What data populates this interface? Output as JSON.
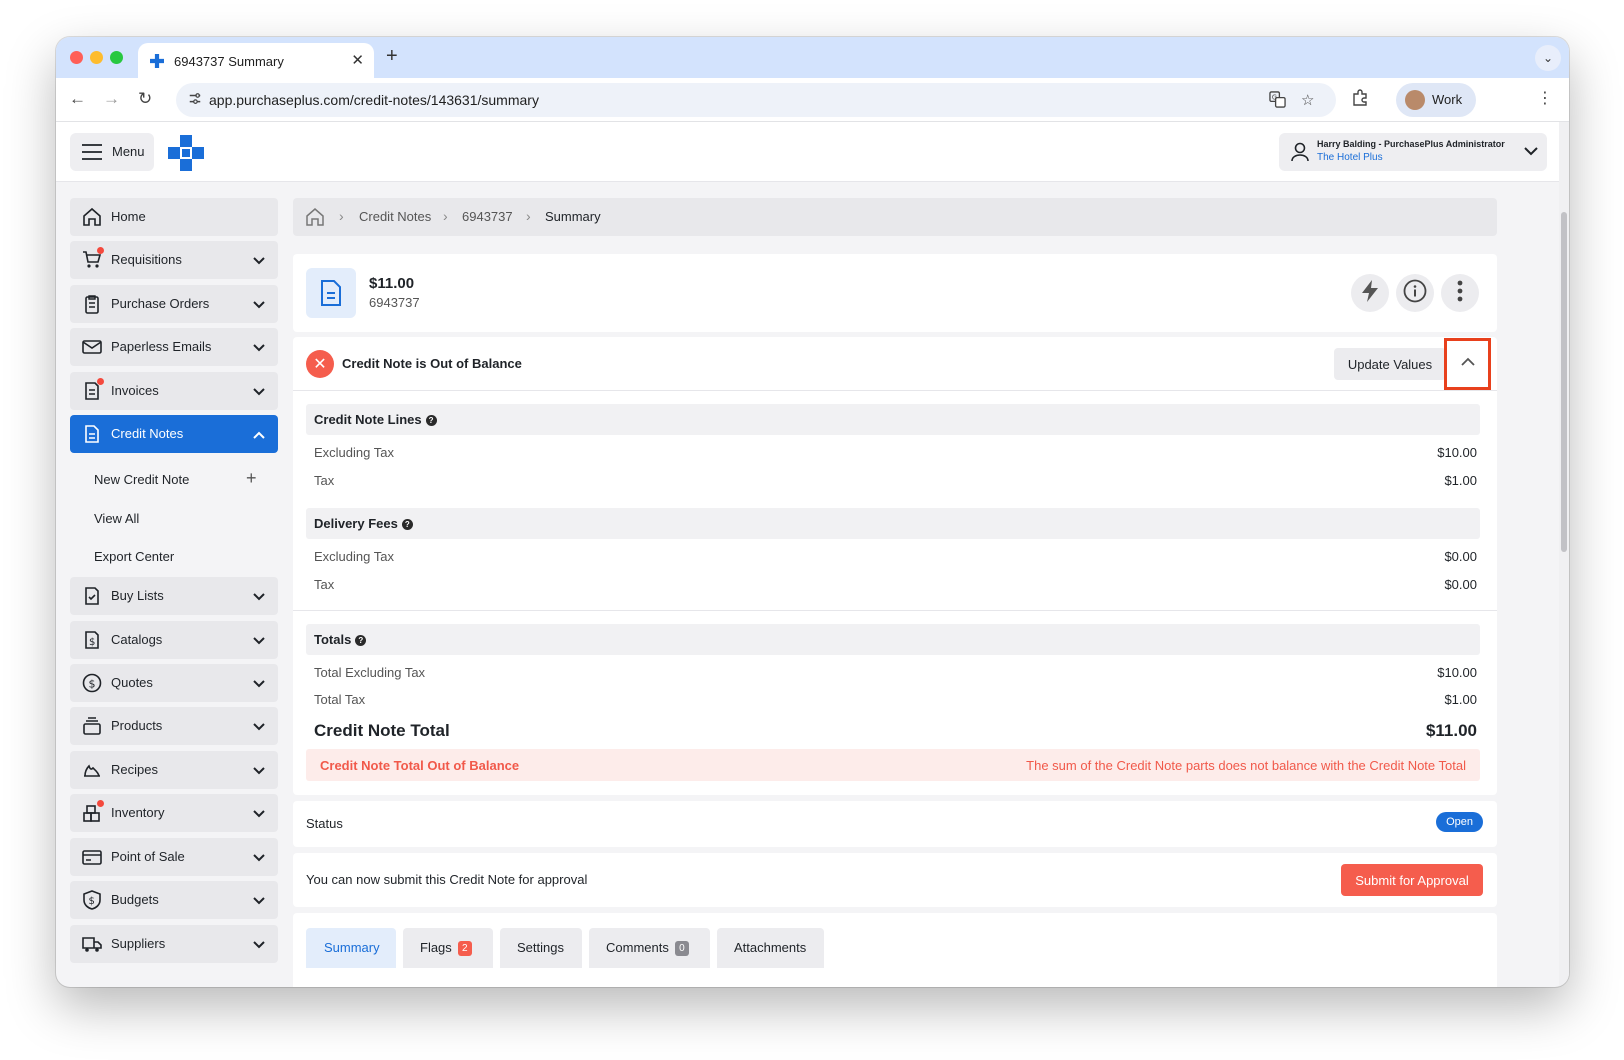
{
  "browser": {
    "tab_title": "6943737 Summary",
    "url": "app.purchaseplus.com/credit-notes/143631/summary",
    "profile_label": "Work",
    "traffic_colors": [
      "#ff5f57",
      "#febc2e",
      "#28c840"
    ]
  },
  "header": {
    "menu_label": "Menu",
    "user_name": "Harry Balding - PurchasePlus Administrator",
    "user_org": "The Hotel Plus"
  },
  "sidebar": {
    "items": [
      {
        "label": "Home",
        "icon": "home-icon"
      },
      {
        "label": "Requisitions",
        "icon": "cart-icon"
      },
      {
        "label": "Purchase Orders",
        "icon": "clipboard-icon"
      },
      {
        "label": "Paperless Emails",
        "icon": "mail-icon"
      },
      {
        "label": "Invoices",
        "icon": "invoice-icon"
      },
      {
        "label": "Credit Notes",
        "icon": "document-icon"
      },
      {
        "label": "Buy Lists",
        "icon": "checklist-icon"
      },
      {
        "label": "Catalogs",
        "icon": "catalog-icon"
      },
      {
        "label": "Quotes",
        "icon": "dollar-circle-icon"
      },
      {
        "label": "Products",
        "icon": "stack-icon"
      },
      {
        "label": "Recipes",
        "icon": "recipe-icon"
      },
      {
        "label": "Inventory",
        "icon": "boxes-icon"
      },
      {
        "label": "Point of Sale",
        "icon": "card-icon"
      },
      {
        "label": "Budgets",
        "icon": "shield-dollar-icon"
      },
      {
        "label": "Suppliers",
        "icon": "truck-icon"
      }
    ],
    "sub_items": [
      "New Credit Note",
      "View All",
      "Export Center"
    ]
  },
  "breadcrumb": {
    "items": [
      "Credit Notes",
      "6943737"
    ],
    "current": "Summary"
  },
  "summary": {
    "amount": "$11.00",
    "number": "6943737"
  },
  "balance": {
    "title": "Credit Note is Out of Balance",
    "update_label": "Update Values",
    "lines": {
      "title": "Credit Note Lines",
      "excl_label": "Excluding Tax",
      "excl_value": "$10.00",
      "tax_label": "Tax",
      "tax_value": "$1.00"
    },
    "delivery": {
      "title": "Delivery Fees",
      "excl_label": "Excluding Tax",
      "excl_value": "$0.00",
      "tax_label": "Tax",
      "tax_value": "$0.00"
    },
    "totals": {
      "title": "Totals",
      "excl_label": "Total Excluding Tax",
      "excl_value": "$10.00",
      "tax_label": "Total Tax",
      "tax_value": "$1.00",
      "grand_label": "Credit Note Total",
      "grand_value": "$11.00"
    },
    "warning_label": "Credit Note Total Out of Balance",
    "warning_text": "The sum of the Credit Note parts does not balance with the Credit Note Total"
  },
  "status": {
    "label": "Status",
    "value": "Open"
  },
  "submit": {
    "text": "You can now submit this Credit Note for approval",
    "button": "Submit for Approval"
  },
  "tabs": [
    {
      "label": "Summary",
      "badge": ""
    },
    {
      "label": "Flags",
      "badge": "2"
    },
    {
      "label": "Settings",
      "badge": ""
    },
    {
      "label": "Comments",
      "badge": "0"
    },
    {
      "label": "Attachments",
      "badge": ""
    }
  ],
  "colors": {
    "accent": "#1a6ed8",
    "danger": "#f55d4d",
    "highlight_border": "#e8401c"
  }
}
